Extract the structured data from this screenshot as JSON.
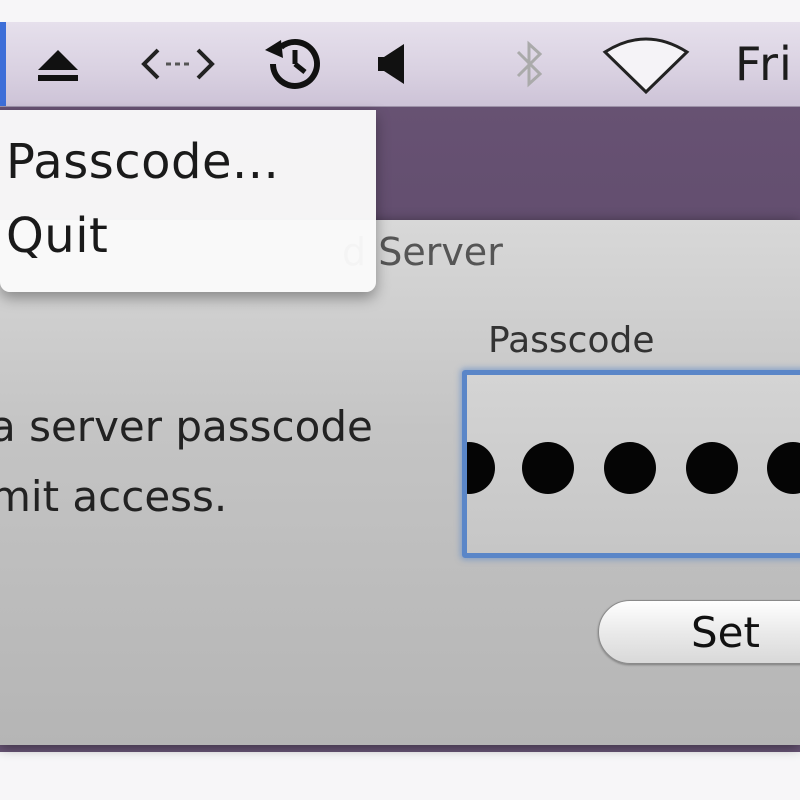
{
  "menubar": {
    "icons": [
      "eject-icon",
      "remote-arrows-icon",
      "time-machine-icon",
      "volume-icon",
      "bluetooth-icon",
      "wifi-icon"
    ],
    "clock": "Fri"
  },
  "menu": {
    "items": [
      {
        "label": "Passcode..."
      },
      {
        "label": "Quit"
      }
    ]
  },
  "window": {
    "title": "d Server",
    "description_line1": "a server passcode",
    "description_line2": "mit access.",
    "field_label": "Passcode",
    "set_button": "Set"
  },
  "colors": {
    "focus_ring": "#5a86c8",
    "selection": "#3d6ed8",
    "desktop": "#5e4a6b"
  }
}
